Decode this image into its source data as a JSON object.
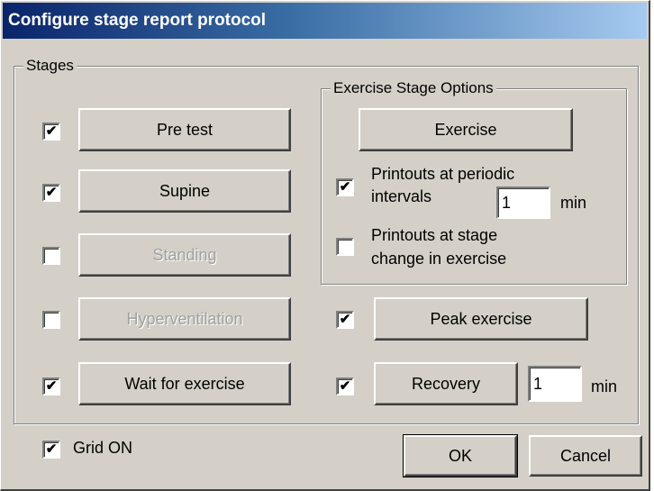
{
  "window": {
    "title": "Configure stage report protocol"
  },
  "stages": {
    "label": "Stages",
    "items": [
      {
        "label": "Pre test",
        "checked": true,
        "enabled": true
      },
      {
        "label": "Supine",
        "checked": true,
        "enabled": true
      },
      {
        "label": "Standing",
        "checked": false,
        "enabled": false
      },
      {
        "label": "Hyperventilation",
        "checked": false,
        "enabled": false
      },
      {
        "label": "Wait for exercise",
        "checked": true,
        "enabled": true
      }
    ]
  },
  "exercise_options": {
    "label": "Exercise Stage Options",
    "exercise_button": "Exercise",
    "periodic": {
      "line1": "Printouts at periodic",
      "line2": "intervals",
      "checked": true,
      "value": "1",
      "unit": "min"
    },
    "stage_change": {
      "line1": "Printouts at stage",
      "line2": "change in exercise",
      "checked": false
    }
  },
  "peak_exercise": {
    "label": "Peak exercise",
    "checked": true
  },
  "recovery": {
    "label": "Recovery",
    "checked": true,
    "value": "1",
    "unit": "min"
  },
  "grid": {
    "label": "Grid ON",
    "checked": true
  },
  "buttons": {
    "ok": "OK",
    "cancel": "Cancel"
  },
  "check_glyph": "✔"
}
